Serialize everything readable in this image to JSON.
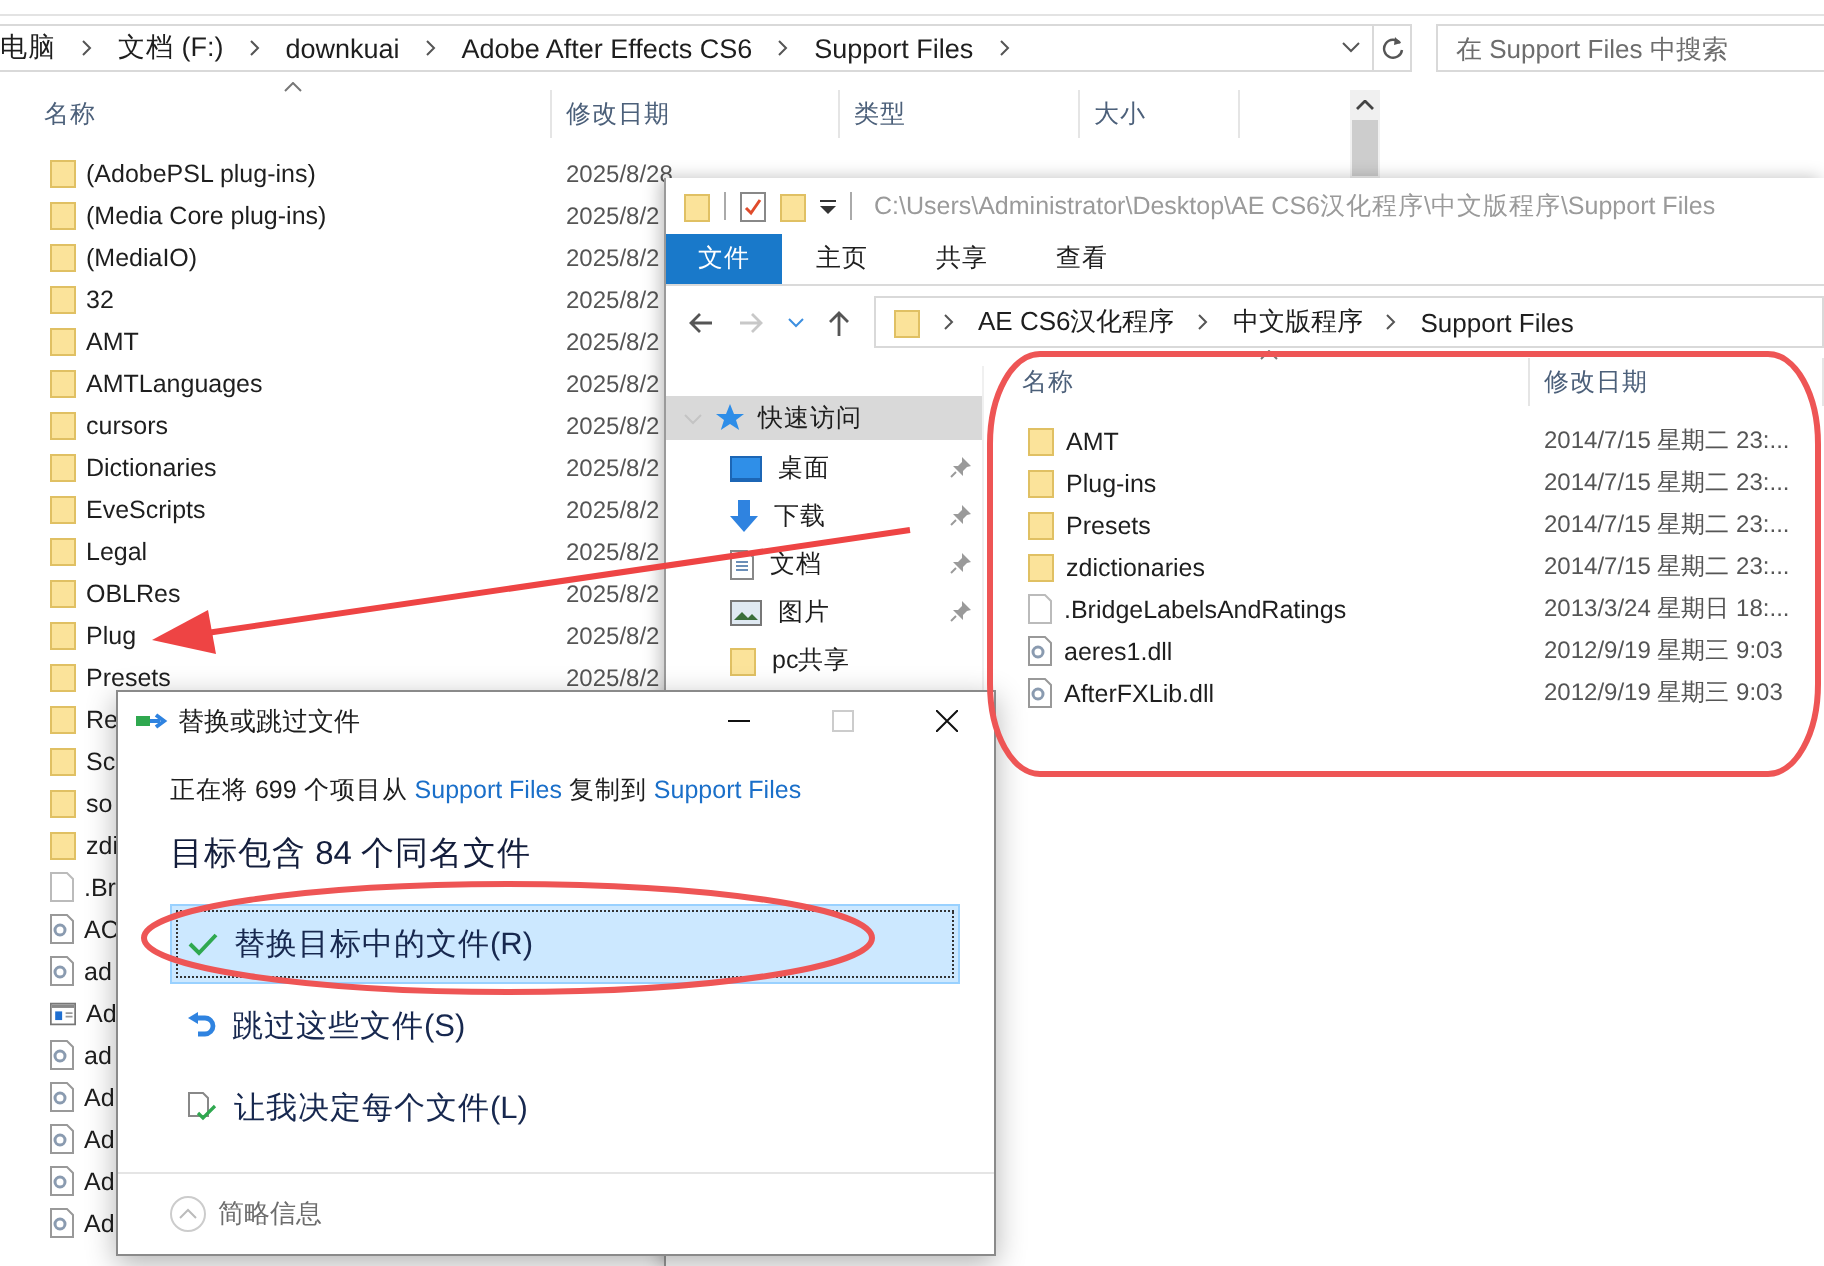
{
  "back_window": {
    "breadcrumb": [
      "电脑",
      "文档 (F:)",
      "downkuai",
      "Adobe After Effects CS6",
      "Support Files"
    ],
    "search": {
      "placeholder": "在 Support Files 中搜索"
    },
    "columns": [
      "名称",
      "修改日期",
      "类型",
      "大小"
    ],
    "rows": [
      {
        "kind": "folder",
        "name": "(AdobePSL plug-ins)",
        "date": "2025/8/28"
      },
      {
        "kind": "folder",
        "name": "(Media Core plug-ins)",
        "date": "2025/8/2"
      },
      {
        "kind": "folder",
        "name": "(MediaIO)",
        "date": "2025/8/2"
      },
      {
        "kind": "folder",
        "name": "32",
        "date": "2025/8/2"
      },
      {
        "kind": "folder",
        "name": "AMT",
        "date": "2025/8/2"
      },
      {
        "kind": "folder",
        "name": "AMTLanguages",
        "date": "2025/8/2"
      },
      {
        "kind": "folder",
        "name": "cursors",
        "date": "2025/8/2"
      },
      {
        "kind": "folder",
        "name": "Dictionaries",
        "date": "2025/8/2"
      },
      {
        "kind": "folder",
        "name": "EveScripts",
        "date": "2025/8/2"
      },
      {
        "kind": "folder",
        "name": "Legal",
        "date": "2025/8/2"
      },
      {
        "kind": "folder",
        "name": "OBLRes",
        "date": "2025/8/2"
      },
      {
        "kind": "folder",
        "name": "Plug",
        "date": "2025/8/2"
      },
      {
        "kind": "folder",
        "name": "Presets",
        "date": "2025/8/2"
      },
      {
        "kind": "folder",
        "name": "Re"
      },
      {
        "kind": "folder",
        "name": "Sc"
      },
      {
        "kind": "folder",
        "name": "so"
      },
      {
        "kind": "folder",
        "name": "zdi"
      },
      {
        "kind": "blank",
        "name": ".Br"
      },
      {
        "kind": "dll",
        "name": "AC"
      },
      {
        "kind": "dll",
        "name": "ad"
      },
      {
        "kind": "app",
        "name": "Ad"
      },
      {
        "kind": "dll",
        "name": "ad"
      },
      {
        "kind": "dll",
        "name": "Ad"
      },
      {
        "kind": "dll",
        "name": "Ad"
      },
      {
        "kind": "dll",
        "name": "Ad"
      },
      {
        "kind": "dll",
        "name": "Ad"
      }
    ]
  },
  "front_window": {
    "title_path": "C:\\Users\\Administrator\\Desktop\\AE CS6汉化程序\\中文版程序\\Support Files",
    "ribbon_tabs": [
      {
        "label": "文件",
        "selected": true
      },
      {
        "label": "主页",
        "selected": false
      },
      {
        "label": "共享",
        "selected": false
      },
      {
        "label": "查看",
        "selected": false
      }
    ],
    "breadcrumb": [
      "AE CS6汉化程序",
      "中文版程序",
      "Support Files"
    ],
    "nav": [
      {
        "label": "快速访问",
        "kind": "star",
        "selected": true,
        "expanded": true,
        "children": [
          {
            "label": "桌面",
            "kind": "desktop",
            "pinned": true,
            "selected": false
          },
          {
            "label": "下载",
            "kind": "download",
            "pinned": true,
            "selected": false
          },
          {
            "label": "文档",
            "kind": "document",
            "pinned": true,
            "selected": false
          },
          {
            "label": "图片",
            "kind": "pictures",
            "pinned": true,
            "selected": false
          },
          {
            "label": "pc共享",
            "kind": "folder",
            "pinned": false,
            "selected": false
          }
        ]
      }
    ],
    "columns": [
      "名称",
      "修改日期"
    ],
    "rows": [
      {
        "kind": "folder",
        "name": "AMT",
        "date": "2014/7/15 星期二 23:..."
      },
      {
        "kind": "folder",
        "name": "Plug-ins",
        "date": "2014/7/15 星期二 23:..."
      },
      {
        "kind": "folder",
        "name": "Presets",
        "date": "2014/7/15 星期二 23:..."
      },
      {
        "kind": "folder",
        "name": "zdictionaries",
        "date": "2014/7/15 星期二 23:..."
      },
      {
        "kind": "blank",
        "name": ".BridgeLabelsAndRatings",
        "date": "2013/3/24 星期日 18:..."
      },
      {
        "kind": "dll",
        "name": "aeres1.dll",
        "date": "2012/9/19 星期三 9:03"
      },
      {
        "kind": "dll",
        "name": "AfterFXLib.dll",
        "date": "2012/9/19 星期三 9:03"
      }
    ]
  },
  "dialog": {
    "title": "替换或跳过文件",
    "message": [
      {
        "kind": "text",
        "text": "正在将 699 个项目从"
      },
      {
        "kind": "link",
        "text": "Support Files"
      },
      {
        "kind": "text",
        "text": "复制到"
      },
      {
        "kind": "link",
        "text": "Support Files"
      }
    ],
    "heading": "目标包含 84 个同名文件",
    "options": [
      {
        "kind": "replace",
        "label": "替换目标中的文件(R)",
        "selected": true
      },
      {
        "kind": "skip",
        "label": "跳过这些文件(S)",
        "selected": false
      },
      {
        "kind": "decide",
        "label": "让我决定每个文件(L)",
        "selected": false
      }
    ],
    "footer": "简略信息"
  }
}
